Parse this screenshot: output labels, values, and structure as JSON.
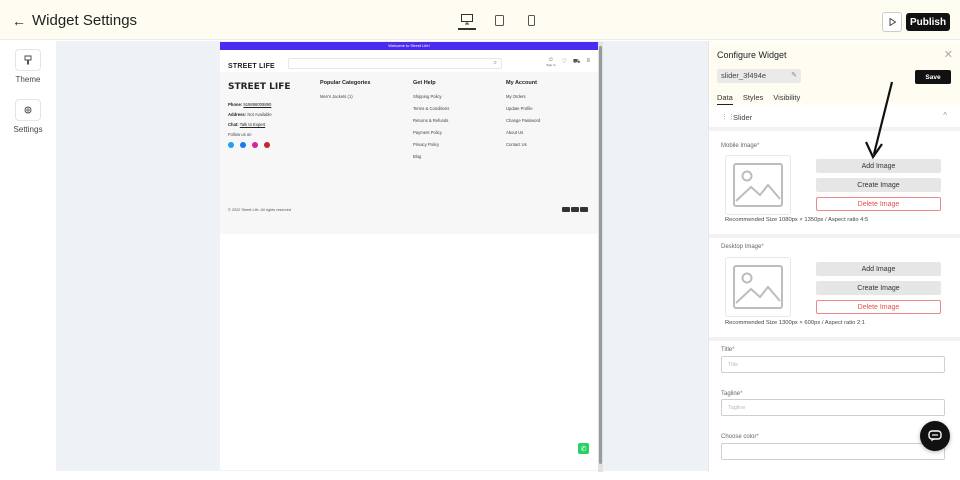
{
  "topbar": {
    "title": "Widget Settings",
    "publish_label": "Publish"
  },
  "sidebar": {
    "items": [
      {
        "label": "Theme",
        "icon": "theme-icon"
      },
      {
        "label": "Settings",
        "icon": "gear-icon"
      }
    ]
  },
  "preview": {
    "promo_text": "Welcome to Street Life!",
    "logo": "STREET LIFE",
    "sign_in": "Sign In",
    "footer": {
      "logo": "STREET LIFE",
      "phone_label": "Phone:",
      "phone": "919898008890",
      "address_label": "Address:",
      "address": "Not Available",
      "chat_label": "Chat:",
      "chat": "Talk to Expert",
      "follow": "Follow us on",
      "popular_title": "Popular Categories",
      "popular": [
        "Men's Jackets (1)"
      ],
      "help_title": "Get Help",
      "help": [
        "Shipping Policy",
        "Terms & Conditions",
        "Returns & Refunds",
        "Payment Policy",
        "Privacy Policy",
        "Blog"
      ],
      "account_title": "My Account",
      "account": [
        "My Orders",
        "Update Profile",
        "Change Password",
        "About Us",
        "Contact Us"
      ],
      "copyright": "© 2022 Street Life. All rights reserved"
    }
  },
  "panel": {
    "title": "Configure Widget",
    "widget_id": "slider_3f494e",
    "save_label": "Save",
    "tabs": [
      "Data",
      "Styles",
      "Visibility"
    ],
    "section": "Slider",
    "mobile_image_label": "Mobile Image",
    "desktop_image_label": "Desktop Image",
    "add_image": "Add Image",
    "create_image": "Create Image",
    "delete_image": "Delete Image",
    "mobile_rec": "Recommended Size 1080px × 1350px / Aspect ratio 4:5",
    "desktop_rec": "Recommended Size 1300px × 600px / Aspect ratio 2:1",
    "title_label": "Title",
    "title_placeholder": "Title",
    "tagline_label": "Tagline",
    "tagline_placeholder": "Tagline",
    "color_label": "Choose color",
    "required_mark": "*"
  },
  "colors": {
    "promo": "#4b2bf0",
    "accent_danger": "#e05050",
    "header_bg": "#fffdf2"
  }
}
